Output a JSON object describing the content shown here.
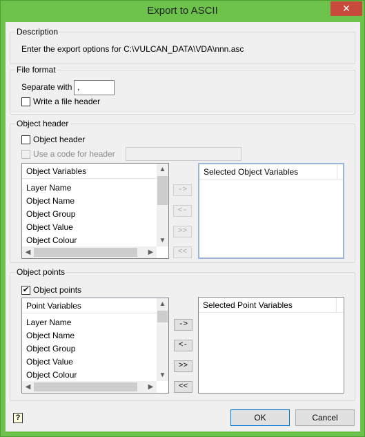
{
  "window": {
    "title": "Export to ASCII",
    "close_glyph": "✕"
  },
  "description": {
    "title": "Description",
    "text": "Enter the export options for C:\\VULCAN_DATA\\VDA\\nnn.asc"
  },
  "file_format": {
    "title": "File format",
    "separate_label": "Separate with",
    "separate_value": ",",
    "write_header_label": "Write a file header",
    "write_header_checked": false
  },
  "object_header": {
    "title": "Object header",
    "checkbox_label": "Object header",
    "checkbox_checked": false,
    "use_code_label": "Use a code for header",
    "code_value": "",
    "available_header": "Object Variables",
    "selected_header": "Selected Object Variables",
    "items": [
      "Layer Name",
      "Object Name",
      "Object Group",
      "Object Value",
      "Object Colour"
    ],
    "buttons": {
      "add": "->",
      "remove": "<-",
      "add_all": ">>",
      "remove_all": "<<"
    }
  },
  "object_points": {
    "title": "Object points",
    "checkbox_label": "Object points",
    "checkbox_checked": true,
    "check_glyph": "✔",
    "available_header": "Point Variables",
    "selected_header": "Selected Point Variables",
    "items": [
      "Layer Name",
      "Object Name",
      "Object Group",
      "Object Value",
      "Object Colour"
    ],
    "buttons": {
      "add": "->",
      "remove": "<-",
      "add_all": ">>",
      "remove_all": "<<"
    }
  },
  "footer": {
    "help_glyph": "?",
    "ok_label": "OK",
    "cancel_label": "Cancel"
  },
  "scroll_glyphs": {
    "up": "▲",
    "down": "▼",
    "left": "◀",
    "right": "▶"
  },
  "colors": {
    "title_bar": "#6cc24a",
    "close_button": "#c74a3c",
    "dialog_bg": "#f0f0f0"
  }
}
